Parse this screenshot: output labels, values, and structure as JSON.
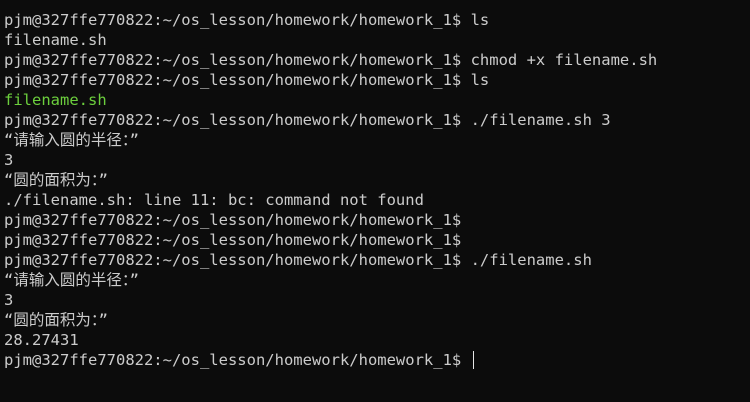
{
  "terminal": {
    "prompt": "pjm@327ffe770822:~/os_lesson/homework/homework_1$",
    "colors": {
      "background": "#0c0c0c",
      "text": "#cccccc",
      "executable": "#6ccf3d"
    },
    "lines": {
      "l0_cmd": " ls",
      "l1_out": "filename.sh",
      "l2_cmd": " chmod +x filename.sh",
      "l3_cmd": " ls",
      "l4_out": "filename.sh",
      "l5_cmd": " ./filename.sh 3",
      "l6_out": "“请输入圆的半径：”",
      "l7_out": "3",
      "l8_out": "“圆的面积为：”",
      "l9_out": "./filename.sh: line 11: bc: command not found",
      "l10_cmd": "",
      "l11_cmd": "",
      "l12_cmd": " ./filename.sh",
      "l13_out": "“请输入圆的半径：”",
      "l14_out": "3",
      "l15_out": "“圆的面积为：”",
      "l16_out": "28.27431",
      "l17_cmd": " "
    }
  }
}
